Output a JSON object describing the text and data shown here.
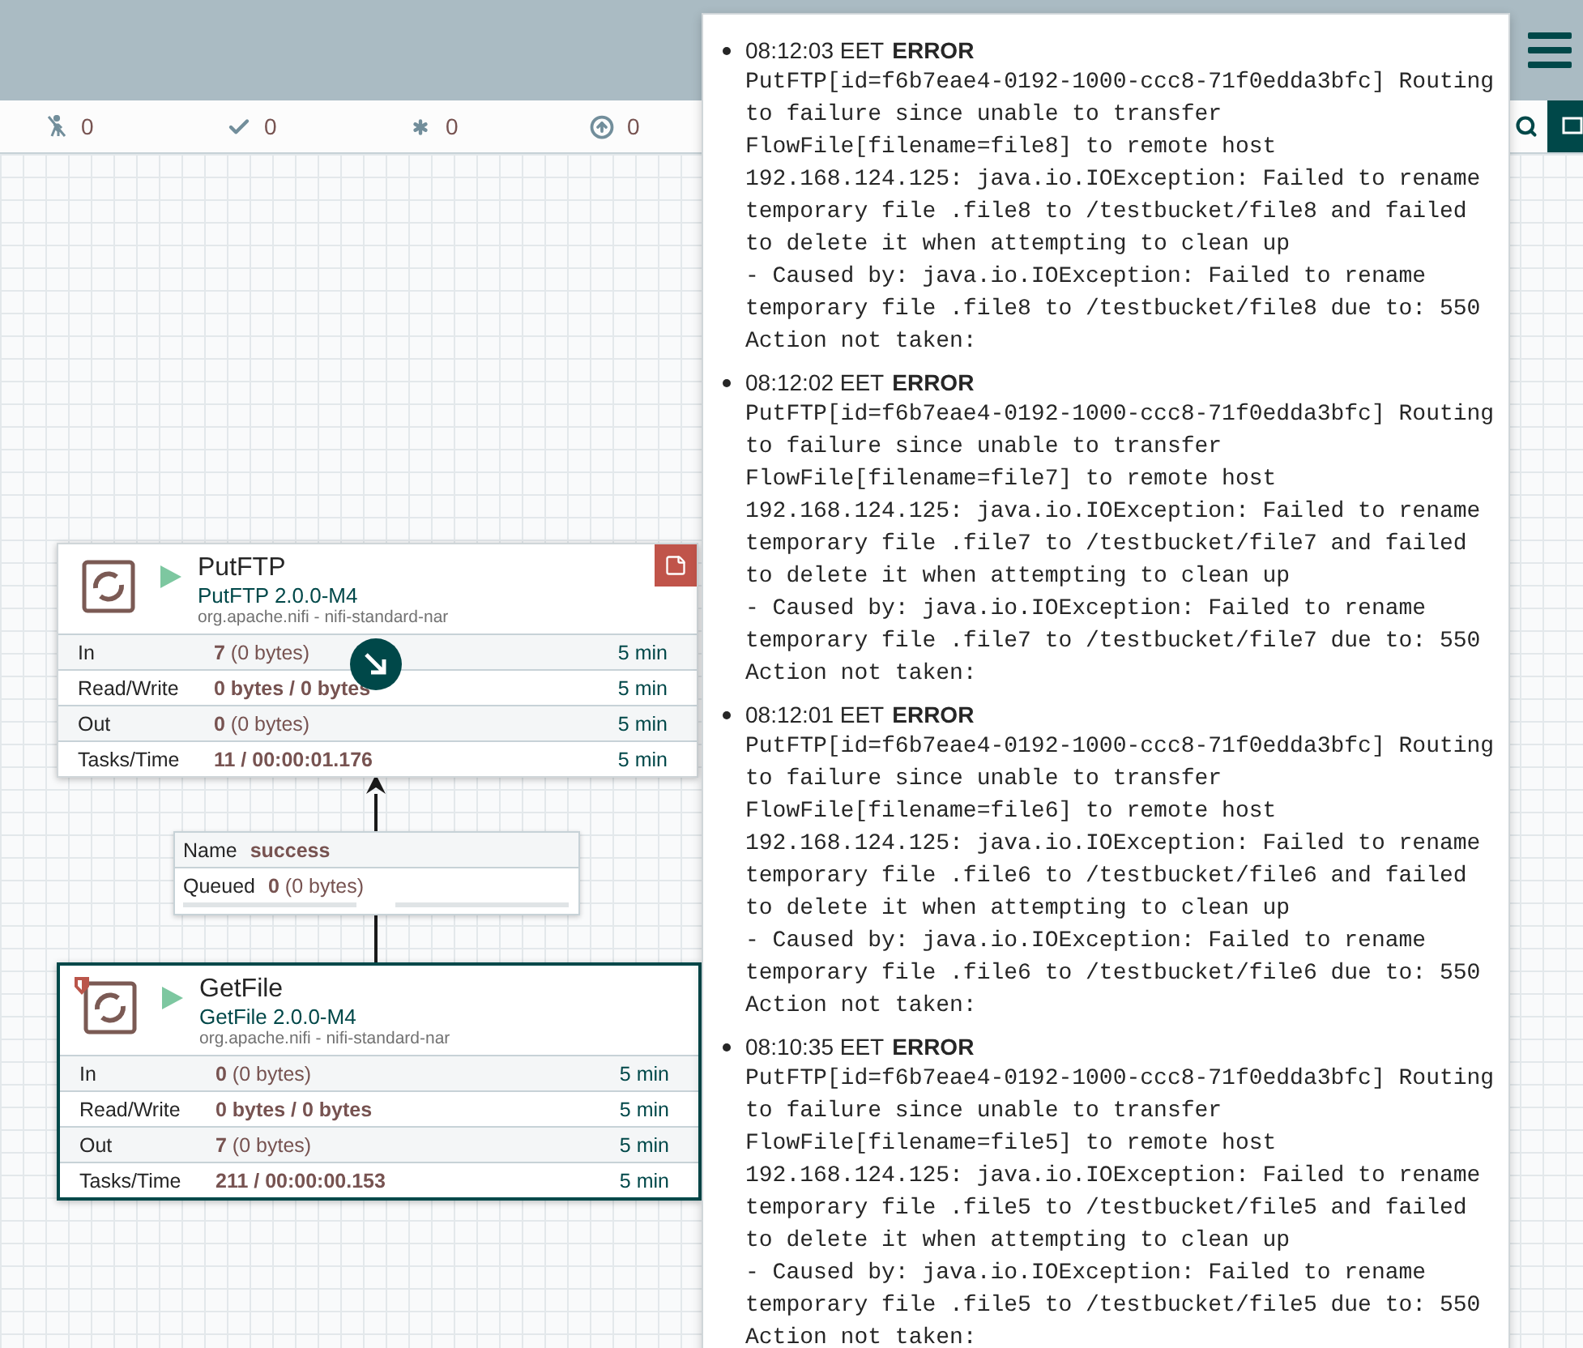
{
  "status_bar": [
    {
      "kind": "not-transmitting",
      "count": "0"
    },
    {
      "kind": "up-to-date",
      "count": "0"
    },
    {
      "kind": "modified",
      "count": "0"
    },
    {
      "kind": "stale",
      "count": "0"
    }
  ],
  "processors": [
    {
      "name": "PutFTP",
      "type": "PutFTP 2.0.0-M4",
      "bundle": "org.apache.nifi - nifi-standard-nar",
      "running": true,
      "restricted": false,
      "has_bulletins": true,
      "selected": false,
      "stats": [
        {
          "label": "In",
          "value": "**7** (0 bytes)",
          "window": "5 min"
        },
        {
          "label": "Read/Write",
          "value": "**0 bytes / 0 bytes**",
          "window": "5 min"
        },
        {
          "label": "Out",
          "value": "**0** (0 bytes)",
          "window": "5 min"
        },
        {
          "label": "Tasks/Time",
          "value": "**11 / 00:00:01.176**",
          "window": "5 min"
        }
      ]
    },
    {
      "name": "GetFile",
      "type": "GetFile 2.0.0-M4",
      "bundle": "org.apache.nifi - nifi-standard-nar",
      "running": true,
      "restricted": true,
      "has_bulletins": false,
      "selected": true,
      "stats": [
        {
          "label": "In",
          "value": "**0** (0 bytes)",
          "window": "5 min"
        },
        {
          "label": "Read/Write",
          "value": "**0 bytes / 0 bytes**",
          "window": "5 min"
        },
        {
          "label": "Out",
          "value": "**7** (0 bytes)",
          "window": "5 min"
        },
        {
          "label": "Tasks/Time",
          "value": "**211 / 00:00:00.153**",
          "window": "5 min"
        }
      ]
    }
  ],
  "connection": {
    "name_label": "Name",
    "name": "success",
    "queued_label": "Queued",
    "queued": "**0** (0 bytes)",
    "backpressure": [
      {
        "level": 0
      },
      {
        "level": 0
      }
    ]
  },
  "bulletins": [
    {
      "time": "08:12:03 EET",
      "level": "ERROR",
      "message": "PutFTP[id=f6b7eae4-0192-1000-ccc8-71f0edda3bfc] Routing to failure since unable to transfer FlowFile[filename=file8] to remote host 192.168.124.125: java.io.IOException: Failed to rename temporary file .file8 to /testbucket/file8 and failed to delete it when attempting to clean up\n- Caused by: java.io.IOException: Failed to rename temporary file .file8 to /testbucket/file8 due to: 550 Action not taken:"
    },
    {
      "time": "08:12:02 EET",
      "level": "ERROR",
      "message": "PutFTP[id=f6b7eae4-0192-1000-ccc8-71f0edda3bfc] Routing to failure since unable to transfer FlowFile[filename=file7] to remote host 192.168.124.125: java.io.IOException: Failed to rename temporary file .file7 to /testbucket/file7 and failed to delete it when attempting to clean up\n- Caused by: java.io.IOException: Failed to rename temporary file .file7 to /testbucket/file7 due to: 550 Action not taken:"
    },
    {
      "time": "08:12:01 EET",
      "level": "ERROR",
      "message": "PutFTP[id=f6b7eae4-0192-1000-ccc8-71f0edda3bfc] Routing to failure since unable to transfer FlowFile[filename=file6] to remote host 192.168.124.125: java.io.IOException: Failed to rename temporary file .file6 to /testbucket/file6 and failed to delete it when attempting to clean up\n- Caused by: java.io.IOException: Failed to rename temporary file .file6 to /testbucket/file6 due to: 550 Action not taken:"
    },
    {
      "time": "08:10:35 EET",
      "level": "ERROR",
      "message": "PutFTP[id=f6b7eae4-0192-1000-ccc8-71f0edda3bfc] Routing to failure since unable to transfer FlowFile[filename=file5] to remote host 192.168.124.125: java.io.IOException: Failed to rename temporary file .file5 to /testbucket/file5 and failed to delete it when attempting to clean up\n- Caused by: java.io.IOException: Failed to rename temporary file .file5 to /testbucket/file5 due to: 550 Action not taken:"
    }
  ]
}
